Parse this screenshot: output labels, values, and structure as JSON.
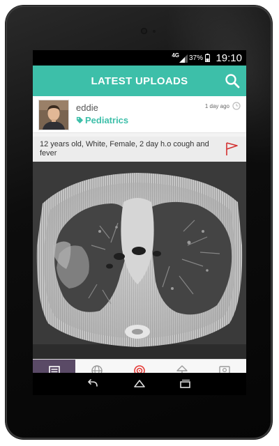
{
  "status_bar": {
    "network": "4G",
    "battery": "37%",
    "time": "19:10"
  },
  "action_bar": {
    "title": "LATEST UPLOADS",
    "search_icon": "search-icon"
  },
  "post": {
    "username": "eddie",
    "specialty": "Pediatrics",
    "timestamp": "1 day ago",
    "caption": "12 years old, White, Female, 2 day h.o cough and fever",
    "flag_color": "#d32f2f"
  },
  "bottom_nav": {
    "tabs": [
      {
        "icon": "feed-icon",
        "active": true
      },
      {
        "icon": "globe-icon",
        "active": false
      },
      {
        "icon": "target-icon",
        "active": false
      },
      {
        "icon": "upload-icon",
        "active": false
      },
      {
        "icon": "profile-icon",
        "active": false
      }
    ]
  },
  "system_nav": {
    "back": "back-icon",
    "home": "home-icon",
    "recents": "recents-icon"
  },
  "colors": {
    "accent": "#3dbfa9",
    "active_tab": "#5a4a66"
  }
}
